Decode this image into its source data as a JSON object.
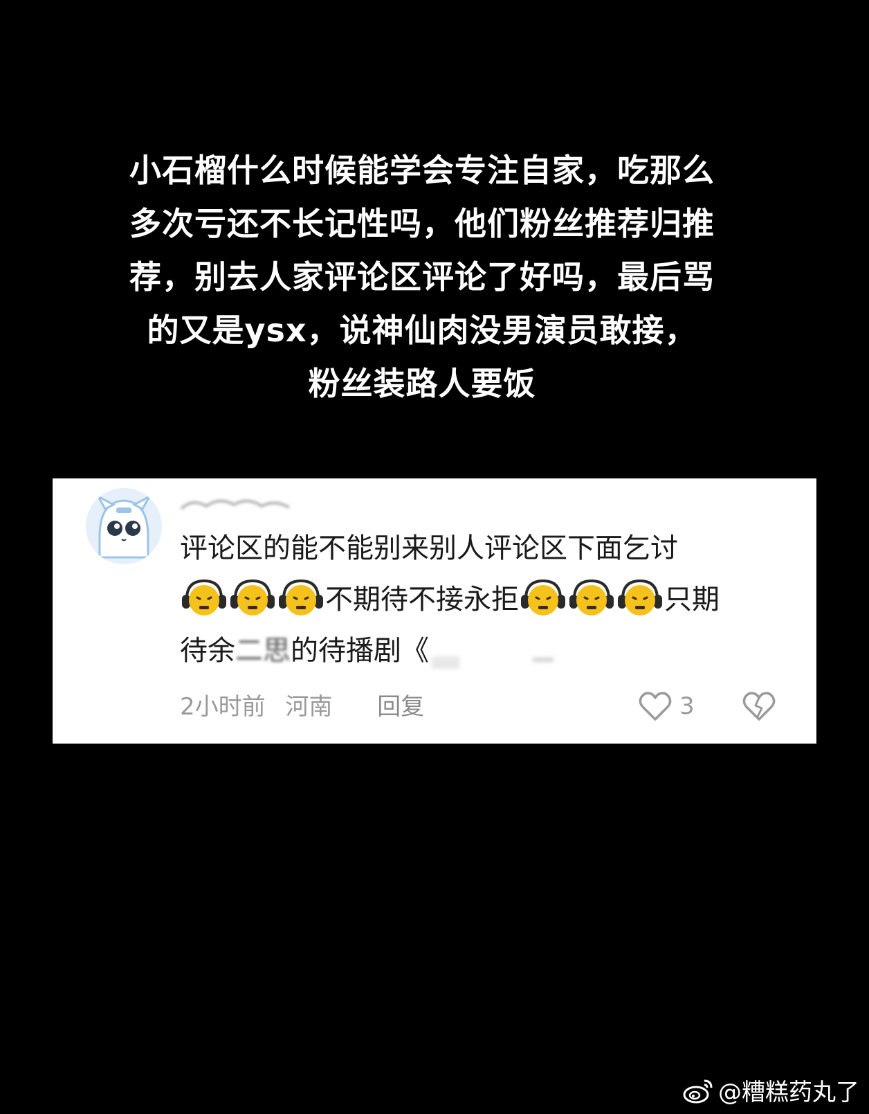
{
  "headline": {
    "lines": [
      "小石榴什么时候能学会专注自家，吃那么",
      "多次亏还不长记性吗，他们粉丝推荐归推",
      "荐，别去人家评论区评论了好吗，最后骂",
      "的又是ysx，说神仙肉没男演员敢接，",
      "粉丝装路人要饭"
    ]
  },
  "comment": {
    "line1": "评论区的能不能别来别人评论区下面乞讨",
    "line2_mid": "不期待不接永拒",
    "line2_end": "只期",
    "line3_start": "待余",
    "line3_blurred": "二思",
    "line3_end": "的待播剧《",
    "emoji_icon": "headphone-frown-emoji-icon",
    "time": "2小时前",
    "location": "河南",
    "reply_label": "回复",
    "like_count": "3"
  },
  "watermark": {
    "text": "@糟糕药丸了",
    "icon": "weibo-logo-icon"
  },
  "colors": {
    "background": "#000000",
    "card": "#ffffff",
    "text_dark": "#1a1a1a",
    "meta_gray": "#9a9a9a"
  }
}
